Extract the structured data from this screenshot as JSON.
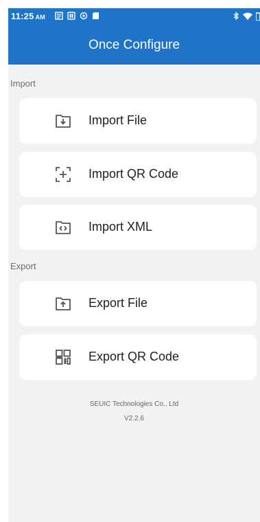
{
  "status_bar": {
    "time": "11:25",
    "ampm": "AM",
    "icons_left": [
      "sim-icon",
      "storage-icon",
      "sync-icon",
      "sdcard-icon"
    ],
    "icons_right": [
      "bluetooth-icon",
      "wifi-icon",
      "battery-icon"
    ]
  },
  "app_bar": {
    "title": "Once Configure",
    "color": "#1f73c9"
  },
  "import_section": {
    "label": "Import",
    "items": [
      {
        "label": "Import File",
        "icon": "folder-import-icon"
      },
      {
        "label": "Import QR Code",
        "icon": "scan-add-icon"
      },
      {
        "label": "Import XML",
        "icon": "folder-code-icon"
      }
    ]
  },
  "export_section": {
    "label": "Export",
    "items": [
      {
        "label": "Export File",
        "icon": "folder-export-icon"
      },
      {
        "label": "Export QR Code",
        "icon": "qr-code-icon"
      }
    ]
  },
  "footer": {
    "company": "SEUIC Technologies Co., Ltd",
    "version": "V2.2.6"
  }
}
